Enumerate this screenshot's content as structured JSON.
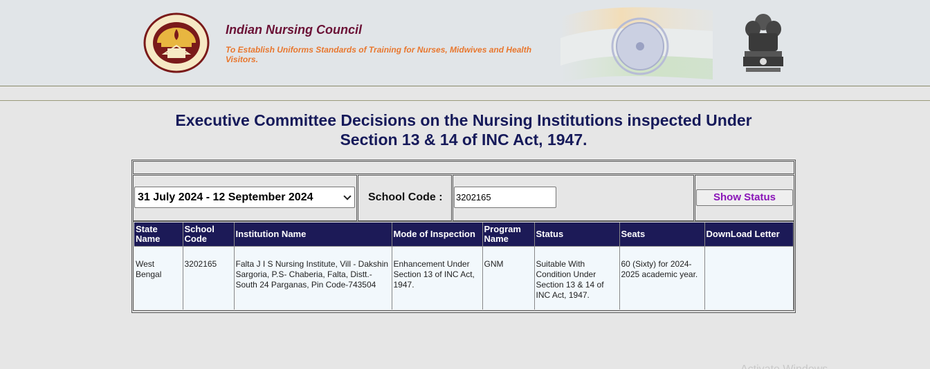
{
  "header": {
    "org_name": "Indian Nursing Council",
    "tagline": "To Establish Uniforms Standards of Training for Nurses, Midwives and Health Visitors.",
    "logo_icon": "inc-logo-icon",
    "emblem_icon": "state-emblem-icon",
    "flag_icon": "indian-flag-icon"
  },
  "page": {
    "title_line1": "Executive Committee Decisions on the Nursing Institutions inspected Under",
    "title_line2": "Section 13 & 14 of INC Act, 1947."
  },
  "filters": {
    "date_range_selected": "31 July 2024 - 12 September 2024",
    "school_code_label": "School Code :",
    "school_code_value": "3202165",
    "show_status_label": "Show Status"
  },
  "table": {
    "headers": [
      "State Name",
      "School Code",
      "Institution Name",
      "Mode of Inspection",
      "Program Name",
      "Status",
      "Seats",
      "DownLoad Letter"
    ],
    "rows": [
      {
        "state_name": "West Bengal",
        "school_code": "3202165",
        "institution_name": "Falta J I S Nursing Institute, Vill - Dakshin Sargoria, P.S- Chaberia, Falta, Distt.- South 24 Parganas, Pin Code-743504",
        "mode_of_inspection": "Enhancement Under Section 13 of INC Act, 1947.",
        "program_name": "GNM",
        "status": "Suitable With Condition Under Section 13 & 14 of INC Act, 1947.",
        "seats": "60 (Sixty) for 2024-2025 academic year.",
        "download_letter": ""
      }
    ]
  },
  "colors": {
    "header_bg": "#e1e5e8",
    "title": "#161a5a",
    "org_name": "#6b1236",
    "tagline": "#e8772e",
    "table_header_bg": "#1c1a57",
    "table_row_bg": "#f2f8fc",
    "button_text": "#8a15b8"
  },
  "watermark": {
    "text": "Activate Windows"
  }
}
